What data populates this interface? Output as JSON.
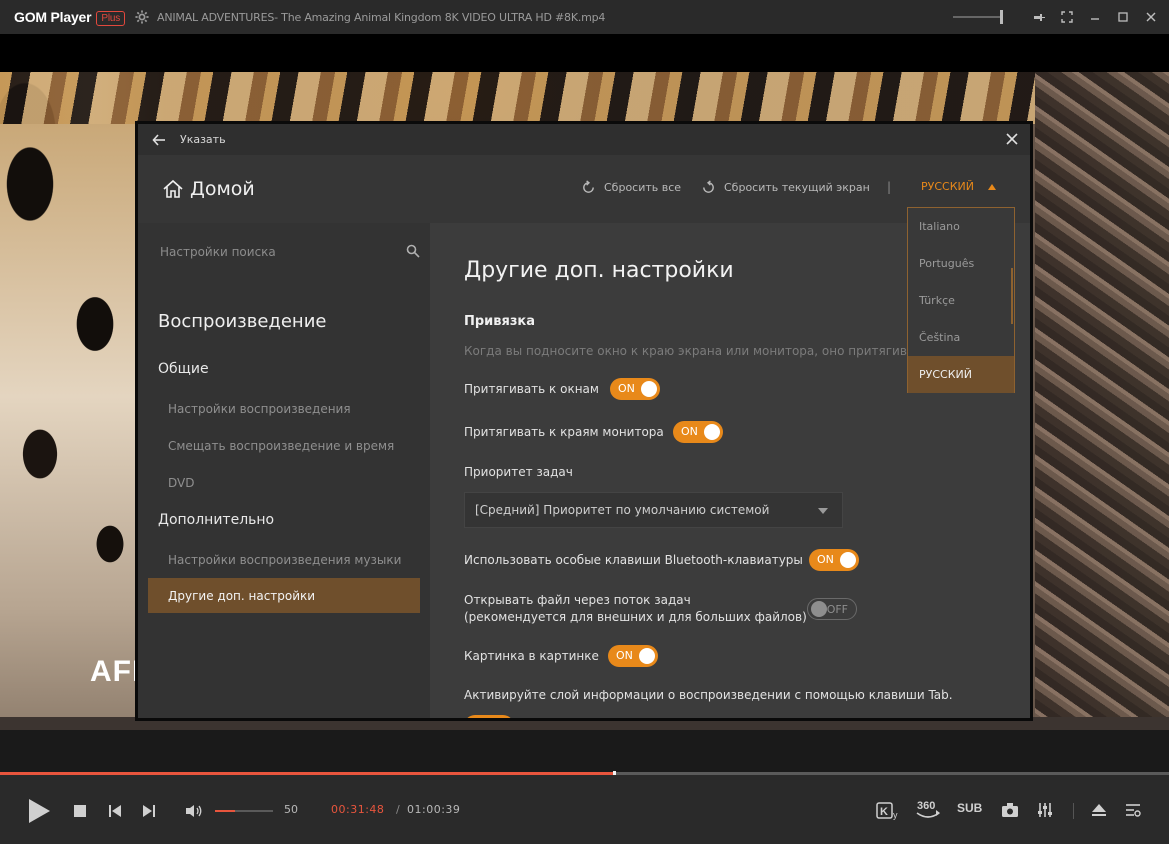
{
  "titlebar": {
    "logo": "GOM Player",
    "logo_badge": "Plus",
    "file_title": "ANIMAL ADVENTURES- The Amazing Animal Kingdom 8K VIDEO ULTRA HD #8K.mp4"
  },
  "video": {
    "overlay_text": "AFR"
  },
  "dialog": {
    "header_title": "Указать",
    "home_label": "Домой",
    "reset_all": "Сбросить все",
    "reset_current": "Сбросить текущий экран",
    "separator": "|",
    "language": "РУССКИЙ"
  },
  "sidebar": {
    "search_placeholder": "Настройки поиска",
    "heading": "Воспроизведение",
    "group_general": "Общие",
    "item_playback": "Настройки воспроизведения",
    "item_shift": "Смещать воспроизведение и время",
    "item_dvd": "DVD",
    "group_advanced": "Дополнительно",
    "item_music": "Настройки воспроизведения музыки",
    "item_other": "Другие доп. настройки"
  },
  "content": {
    "title": "Другие доп. настройки",
    "section": "Привязка",
    "desc": "Когда вы подносите окно к краю экрана или монитора, оно притягивается",
    "snap_windows": "Притягивать к окнам",
    "snap_monitor": "Притягивать к краям монитора",
    "priority_label": "Приоритет задач",
    "priority_value": "[Средний] Приоритет по умолчанию системой",
    "bt_keys": "Использовать особые клавиши Bluetooth-клавиатуры",
    "open_thread_1": "Открывать файл через поток задач",
    "open_thread_2": "(рекомендуется для внешних и для больших файлов)",
    "pip": "Картинка в картинке",
    "tab_info": "Активируйте слой информации о воспроизведении с помощью клавиши Tab.",
    "on": "ON",
    "off": "OFF"
  },
  "language_menu": {
    "options": [
      "Italiano",
      "Português",
      "Türkçe",
      "Čeština",
      "РУССКИЙ"
    ],
    "selected": "РУССКИЙ"
  },
  "controls": {
    "volume_value": "50",
    "volume_fraction": 0.35,
    "time_current": "00:31:48",
    "time_separator": "/",
    "time_total": "01:00:39",
    "progress_fraction": 0.524,
    "sub_label": "SUB",
    "vr_label": "360"
  },
  "colors": {
    "accent": "#e8891a",
    "progress": "#e8553d",
    "active_item": "#6f4f2c"
  }
}
